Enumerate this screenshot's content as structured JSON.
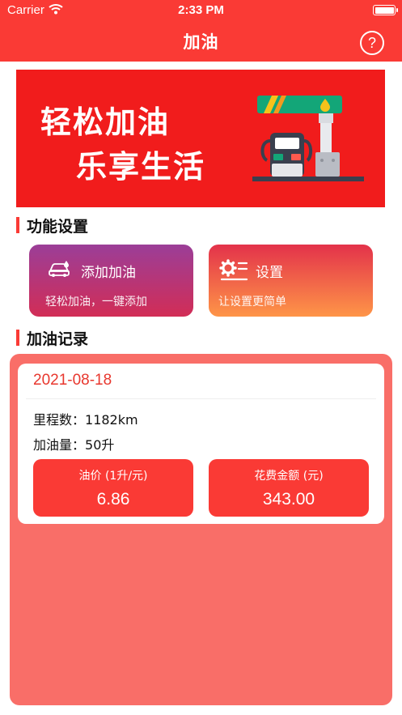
{
  "status_bar": {
    "carrier": "Carrier",
    "time": "2:33 PM"
  },
  "nav": {
    "title": "加油",
    "help_glyph": "?"
  },
  "banner": {
    "line1": "轻松加油",
    "line2": "乐享生活",
    "icon": "gas-station-illustration"
  },
  "sections": {
    "features": "功能设置",
    "records": "加油记录"
  },
  "features": [
    {
      "title": "添加加油",
      "subtitle": "轻松加油，一键添加",
      "icon": "car-fuel-icon"
    },
    {
      "title": "设置",
      "subtitle": "让设置更简单",
      "icon": "gear-list-icon"
    }
  ],
  "record": {
    "date": "2021-08-18",
    "mileage_label": "里程数：",
    "mileage": "1182km",
    "volume_label": "加油量：",
    "volume": "50升",
    "price_label": "油价 (1升/元)",
    "price": "6.86",
    "total_label": "花费金额 (元)",
    "total": "343.00"
  },
  "colors": {
    "primary": "#fa3a35",
    "banner": "#f11c1c",
    "panel": "#f96e68",
    "card_add_top": "#9b3e98",
    "card_add_bottom": "#d22d56",
    "card_settings_top": "#e3324a",
    "card_settings_bottom": "#fe9548"
  }
}
